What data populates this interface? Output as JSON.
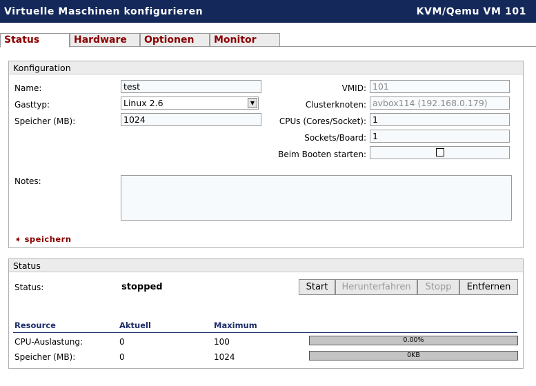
{
  "window": {
    "title": "Virtuelle Maschinen konfigurieren",
    "vm_title": "KVM/Qemu VM 101"
  },
  "tabs": [
    {
      "label": "Status"
    },
    {
      "label": "Hardware"
    },
    {
      "label": "Optionen"
    },
    {
      "label": "Monitor"
    }
  ],
  "config": {
    "header": "Konfiguration",
    "name_label": "Name:",
    "name_value": "test",
    "guest_type_label": "Gasttyp:",
    "guest_type_value": "Linux 2.6",
    "memory_label": "Speicher (MB):",
    "memory_value": "1024",
    "vmid_label": "VMID:",
    "vmid_value": "101",
    "cluster_label": "Clusterknoten:",
    "cluster_value": "avbox114 (192.168.0.179)",
    "cpus_label": "CPUs (Cores/Socket):",
    "cpus_value": "1",
    "sockets_label": "Sockets/Board:",
    "sockets_value": "1",
    "boot_label": "Beim Booten starten:",
    "boot_checked": false,
    "notes_label": "Notes:",
    "notes_value": "",
    "save_label": "speichern"
  },
  "status": {
    "header": "Status",
    "status_label": "Status:",
    "status_value": "stopped",
    "buttons": {
      "start": "Start",
      "shutdown": "Herunterfahren",
      "stop": "Stopp",
      "remove": "Entfernen"
    },
    "table": {
      "headers": [
        "Resource",
        "Aktuell",
        "Maximum"
      ],
      "rows": [
        {
          "resource": "CPU-Auslastung:",
          "current": "0",
          "maximum": "100",
          "bar_text": "0.00%",
          "usage_fraction": 0
        },
        {
          "resource": "Speicher (MB):",
          "current": "0",
          "maximum": "1024",
          "bar_text": "0KB",
          "usage_fraction": 0
        }
      ]
    }
  },
  "colors": {
    "title_bar": "#14285a",
    "tab_text": "#8b0000",
    "table_header": "#1c2d6a"
  }
}
